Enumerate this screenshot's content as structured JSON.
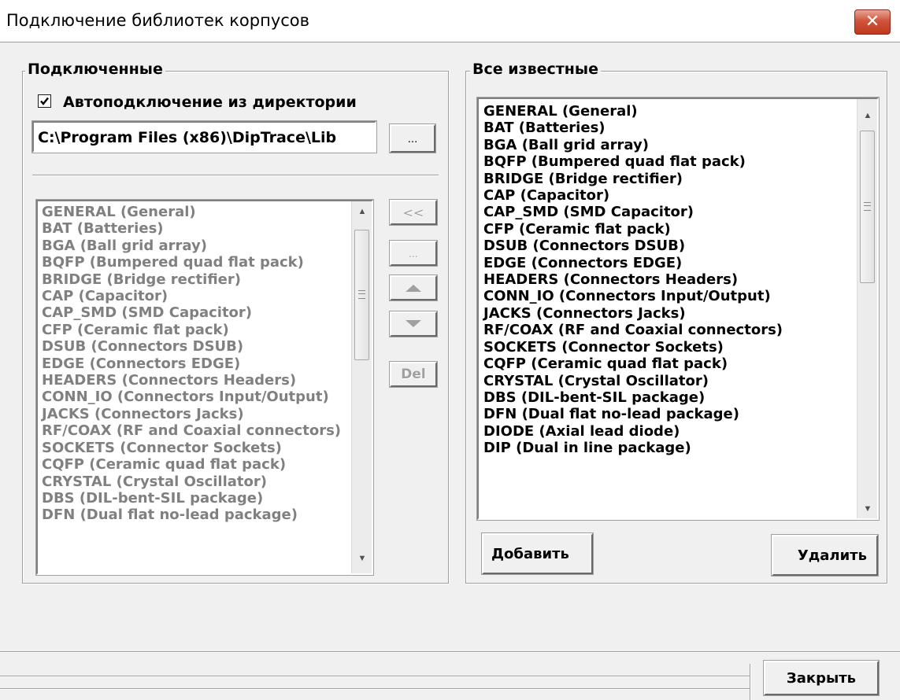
{
  "window": {
    "title": "Подключение библиотек корпусов",
    "close_glyph": "✕"
  },
  "connected": {
    "legend": "Подключенные",
    "auto_checkbox_label": "Автоподключение из директории",
    "auto_checked": true,
    "path_value": "C:\\Program Files (x86)\\DipTrace\\Lib",
    "browse_label": "...",
    "items": [
      "GENERAL (General)",
      "BAT (Batteries)",
      "BGA (Ball grid array)",
      "BQFP (Bumpered quad flat pack)",
      "BRIDGE (Bridge rectifier)",
      "CAP (Capacitor)",
      "CAP_SMD (SMD Capacitor)",
      "CFP (Ceramic flat pack)",
      "DSUB (Connectors DSUB)",
      "EDGE (Connectors EDGE)",
      "HEADERS (Connectors Headers)",
      "CONN_IO (Connectors Input/Output)",
      "JACKS (Connectors Jacks)",
      "RF/COAX (RF and Coaxial connectors)",
      "SOCKETS (Connector Sockets)",
      "CQFP (Ceramic quad flat pack)",
      "CRYSTAL (Crystal Oscillator)",
      "DBS (DIL-bent-SIL package)",
      "DFN (Dual flat no-lead package)"
    ]
  },
  "side_buttons": {
    "move_left": "<<",
    "dots": "...",
    "up_icon": "arrow-up-icon",
    "down_icon": "arrow-down-icon",
    "del": "Del"
  },
  "known": {
    "legend": "Все известные",
    "items": [
      "GENERAL (General)",
      "BAT (Batteries)",
      "BGA (Ball grid array)",
      "BQFP (Bumpered quad flat pack)",
      "BRIDGE (Bridge rectifier)",
      "CAP (Capacitor)",
      "CAP_SMD (SMD Capacitor)",
      "CFP (Ceramic flat pack)",
      "DSUB (Connectors DSUB)",
      "EDGE (Connectors EDGE)",
      "HEADERS (Connectors Headers)",
      "CONN_IO (Connectors Input/Output)",
      "JACKS (Connectors Jacks)",
      "RF/COAX (RF and Coaxial connectors)",
      "SOCKETS (Connector Sockets)",
      "CQFP (Ceramic quad flat pack)",
      "CRYSTAL (Crystal Oscillator)",
      "DBS (DIL-bent-SIL package)",
      "DFN (Dual flat no-lead package)",
      "DIODE (Axial lead diode)",
      "DIP (Dual in line package)"
    ],
    "add_label": "Добавить",
    "remove_label": "Удалить"
  },
  "footer": {
    "close_label": "Закрыть"
  },
  "colors": {
    "disabled_text": "#808080",
    "close_button": "#c0391f"
  }
}
